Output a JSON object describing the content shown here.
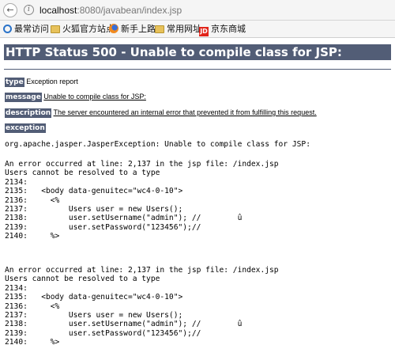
{
  "browser": {
    "url_host": "localhost",
    "url_rest": ":8080/javabean/index.jsp",
    "bookmarks": [
      {
        "label": "最常访问",
        "icon": "gear-icon"
      },
      {
        "label": "火狐官方站点",
        "icon": "folder-icon"
      },
      {
        "label": "新手上路",
        "icon": "firefox-icon"
      },
      {
        "label": "常用网址",
        "icon": "folder-icon"
      },
      {
        "label": "京东商城",
        "icon": "jd-icon"
      }
    ],
    "jd_badge": "JD"
  },
  "page": {
    "title": "HTTP Status 500 - Unable to compile class for JSP:",
    "type_label": "type",
    "type_value": "Exception report",
    "message_label": "message",
    "message_value": "Unable to compile class for JSP:",
    "description_label": "description",
    "description_value": "The server encountered an internal error that prevented it from fulfilling this request.",
    "exception_label": "exception",
    "exception_text": "org.apache.jasper.JasperException: Unable to compile class for JSP:",
    "error_block_1": "An error occurred at line: 2,137 in the jsp file: /index.jsp\nUsers cannot be resolved to a type\n2134:\n2135:   <body data-genuitec=\"wc4-0-10\">\n2136:     <%\n2137:         Users user = new Users();\n2138:         user.setUsername(\"admin\"); //        û\n2139:         user.setPassword(\"123456\");//\n2140:     %>",
    "error_block_2": "An error occurred at line: 2,137 in the jsp file: /index.jsp\nUsers cannot be resolved to a type\n2134:\n2135:   <body data-genuitec=\"wc4-0-10\">\n2136:     <%\n2137:         Users user = new Users();\n2138:         user.setUsername(\"admin\"); //        û\n2139:         user.setPassword(\"123456\");//\n2140:     %>"
  }
}
